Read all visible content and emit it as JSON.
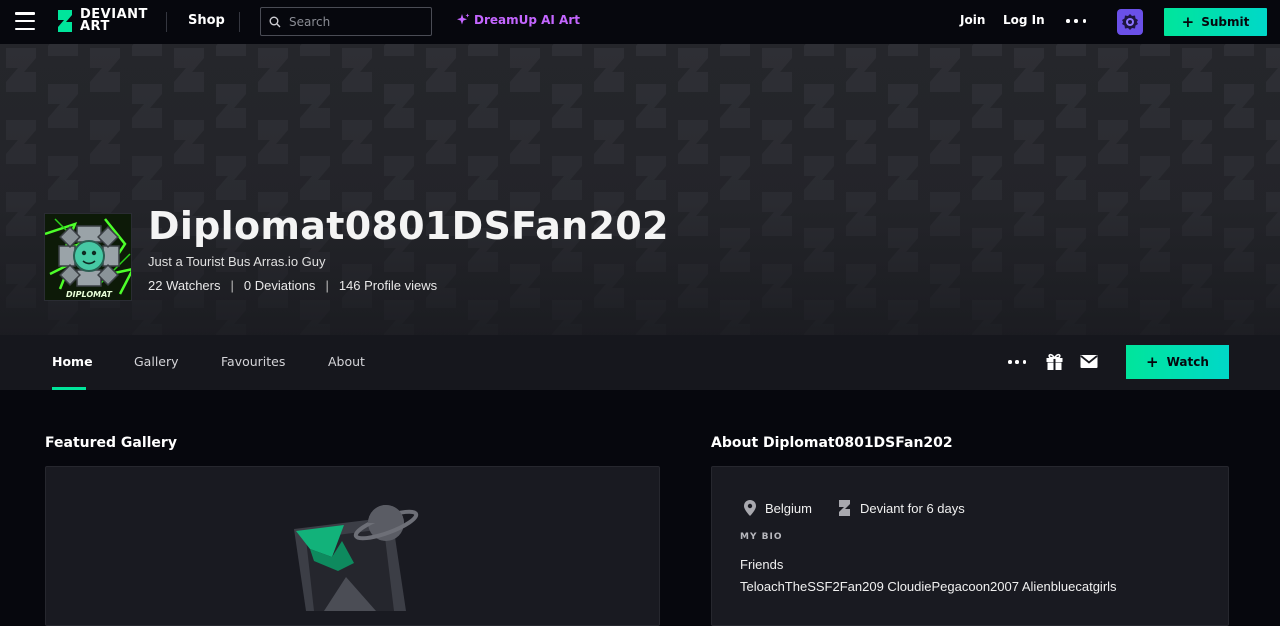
{
  "topbar": {
    "logo_line1": "DEVIANT",
    "logo_line2": "ART",
    "shop_label": "Shop",
    "search_placeholder": "Search",
    "dreamup_label": "DreamUp AI Art",
    "join_label": "Join",
    "login_label": "Log In",
    "submit_label": "Submit"
  },
  "profile": {
    "username": "Diplomat0801DSFan202",
    "tagline": "Just a Tourist Bus Arras.io Guy",
    "avatar_caption": "DIPLOMAT",
    "stats": [
      {
        "label": "22 Watchers"
      },
      {
        "label": "0 Deviations"
      },
      {
        "label": "146 Profile views"
      }
    ]
  },
  "tabs": {
    "items": [
      {
        "label": "Home",
        "active": true
      },
      {
        "label": "Gallery",
        "active": false
      },
      {
        "label": "Favourites",
        "active": false
      },
      {
        "label": "About",
        "active": false
      }
    ],
    "watch_label": "Watch"
  },
  "featured": {
    "title": "Featured Gallery"
  },
  "about": {
    "title": "About Diplomat0801DSFan202",
    "location": "Belgium",
    "deviant_for": "Deviant for 6 days",
    "bio_label": "MY BIO",
    "bio_heading": "Friends",
    "bio_text": "TeloachTheSSF2Fan209 CloudiePegacoon2007 Alienbluecatgirls"
  },
  "colors": {
    "accent": "#00e59b",
    "dreamup": "#c466ff",
    "avatar_button": "#6a50e8",
    "background": "#06070d"
  }
}
